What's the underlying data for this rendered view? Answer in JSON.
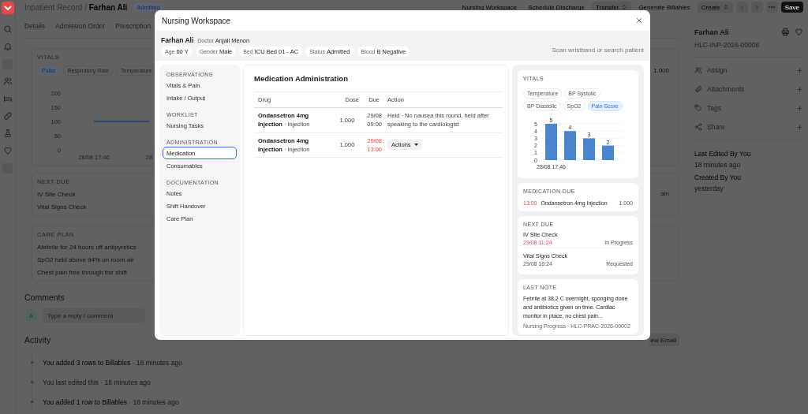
{
  "page": {
    "breadcrumb": "Inpatient Record / **Farhan Ali**",
    "status": "Admitted",
    "actions": [
      {
        "label": "Nursing Workspace",
        "kind": "button"
      },
      {
        "label": "Schedule Discharge",
        "kind": "button"
      },
      {
        "label": "Transfer",
        "kind": "select"
      },
      {
        "label": "Generate Billables",
        "kind": "button"
      },
      {
        "label": "Create",
        "kind": "select"
      },
      {
        "label": "Save",
        "kind": "primary"
      }
    ],
    "tabs": [
      "Details",
      "Admission Order",
      "Prescription"
    ],
    "vitals": {
      "title": "VITALS",
      "chips": [
        {
          "label": "Pulse",
          "selected": true
        },
        {
          "label": "Respiratory Rate",
          "selected": false
        },
        {
          "label": "Temperature",
          "selected": false
        }
      ],
      "value": "1.000",
      "chart_data": {
        "type": "line",
        "categories": [
          "28/08 17:46",
          "28"
        ],
        "values": [
          100,
          100
        ],
        "ylim": [
          0,
          200
        ],
        "yticks": [
          0,
          50,
          100,
          150,
          200
        ]
      }
    },
    "next_due": {
      "title": "NEXT DUE",
      "items": [
        "IV Site Check",
        "Vital Signs Check"
      ],
      "fragment": "ain"
    },
    "care_plan": {
      "title": "CARE PLAN",
      "items": [
        "Afebrile for 24 hours off antipyretics",
        "SpO2 held above 94% on room air",
        "Chest pain free through the shift"
      ]
    },
    "comments": {
      "title": "Comments",
      "avatar": "A",
      "placeholder": "Type a reply / comment"
    },
    "activity": {
      "title": "Activity",
      "button": "ew Email",
      "items": [
        "**You added 3 rows to Billables** · 18 minutes ago",
        "You last edited this · 18 minutes ago",
        "**You added 1 row to Billables** · 18 minutes ago"
      ]
    },
    "sidebar": {
      "title": "Farhan Ali",
      "id": "HLC-INP-2026-00008",
      "actions": [
        {
          "label": "Assign",
          "kind": "assign"
        },
        {
          "label": "Attachments",
          "kind": "attachments"
        },
        {
          "label": "Tags",
          "kind": "tags"
        },
        {
          "label": "Share",
          "kind": "share"
        }
      ],
      "meta": [
        {
          "label": "Last Edited By You",
          "value": "18 minutes ago"
        },
        {
          "label": "Created By You",
          "value": "yesterday"
        }
      ]
    }
  },
  "modal": {
    "title": "Nursing Workspace",
    "patient": {
      "name": "Farhan Ali",
      "doctor": "Doctor **Anjali Menon**",
      "facts": [
        "Age **60 Y**",
        "Gender **Male**",
        "Bed **ICU Bed 01 - AC**",
        "Status **Admitted**",
        "Blood **B Negative**"
      ]
    },
    "search": {
      "placeholder": "Scan wristband or search patient"
    },
    "nav": [
      {
        "heading": "OBSERVATIONS",
        "items": [
          {
            "label": "Vitals & Pain",
            "selected": false
          },
          {
            "label": "Intake / Output",
            "selected": false
          }
        ]
      },
      {
        "heading": "WORKLIST",
        "items": [
          {
            "label": "Nursing Tasks",
            "selected": false
          }
        ]
      },
      {
        "heading": "ADMINISTRATION",
        "items": [
          {
            "label": "Medication",
            "selected": true
          },
          {
            "label": "Consumables",
            "selected": false
          }
        ]
      },
      {
        "heading": "DOCUMENTATION",
        "items": [
          {
            "label": "Notes",
            "selected": false
          },
          {
            "label": "Shift Handover",
            "selected": false
          },
          {
            "label": "Care Plan",
            "selected": false
          }
        ]
      }
    ],
    "medication": {
      "title": "Medication Administration",
      "columns": [
        "Drug",
        "Dose",
        "Due",
        "Action"
      ],
      "rows": [
        {
          "drug": "**Ondansetron 4mg Injection** · Injection",
          "dose": "1.000",
          "due": "29/08 09:00",
          "overdue": false,
          "action": {
            "kind": "note",
            "text": "Held · No nausea this round, held after speaking to the cardiologist"
          }
        },
        {
          "drug": "**Ondansetron 4mg Injection** · Injection",
          "dose": "1.000",
          "due": "29/08 13:00",
          "overdue": true,
          "action": {
            "kind": "menu",
            "text": "Actions"
          }
        }
      ]
    },
    "vitals": {
      "title": "VITALS",
      "chips": [
        {
          "label": "Temperature",
          "selected": false
        },
        {
          "label": "BP Systolic",
          "selected": false
        },
        {
          "label": "BP Diastolic",
          "selected": false
        },
        {
          "label": "SpO2",
          "selected": false
        },
        {
          "label": "Pain Score",
          "selected": true
        }
      ],
      "chart_data": {
        "type": "bar",
        "categories": [
          "28/08 17:46",
          null,
          null,
          null
        ],
        "values": [
          5,
          4,
          3,
          2
        ],
        "ylim": [
          0,
          5
        ],
        "yticks": [
          0,
          1,
          2,
          3,
          4,
          5
        ],
        "grid": true,
        "data_labels": true
      }
    },
    "medication_due": {
      "title": "MEDICATION DUE",
      "items": [
        {
          "time": "13:00",
          "overdue": true,
          "drug": "Ondansetron 4mg Injection",
          "dose": "1.000"
        }
      ]
    },
    "next_due": {
      "title": "NEXT DUE",
      "items": [
        {
          "name": "IV Site Check",
          "time": "29/08 11:24",
          "overdue": true,
          "status": "In Progress"
        },
        {
          "name": "Vital Signs Check",
          "time": "29/08 16:24",
          "overdue": false,
          "status": "Requested"
        }
      ]
    },
    "last_note": {
      "title": "LAST NOTE",
      "text": "Febrile at 38.2 C overnight, sponging done and antibiotics given on time. Cardiac monitor in place, no chest pain...",
      "source": "Nursing Progress · HLC-PRAC-2026-00002"
    }
  }
}
